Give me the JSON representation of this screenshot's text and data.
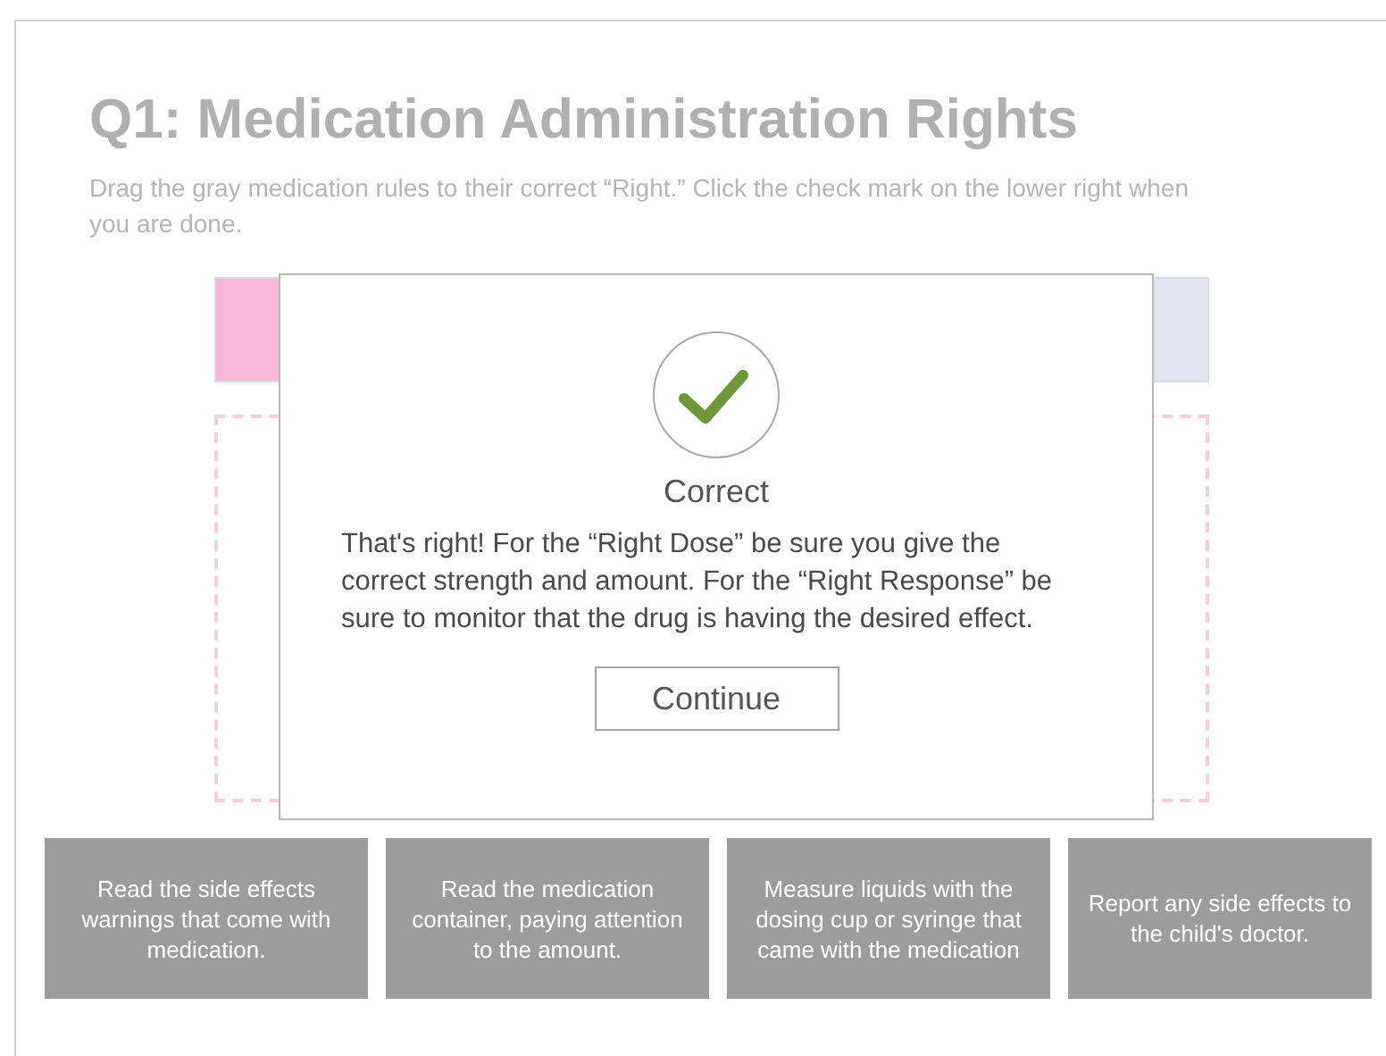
{
  "title": "Q1: Medication Administration Rights",
  "instructions": "Drag the gray medication rules to their correct “Right.”  Click the check mark on the lower right when you are done.",
  "targets": [
    {
      "color": "#f5b8d6"
    },
    {
      "color": "#e1e6ee"
    }
  ],
  "dialog": {
    "heading": "Correct",
    "message": "That's right!  For the “Right Dose”  be sure you give the correct strength and amount. For the “Right Response” be sure to monitor that the drug is having the desired effect.",
    "button": "Continue"
  },
  "rules": [
    "Read the side effects warnings that come with medication.",
    "Read the medication container, paying attention to the amount.",
    "Measure liquids with the dosing cup or syringe that came with the medication",
    "Report any side effects to the child's doctor."
  ]
}
